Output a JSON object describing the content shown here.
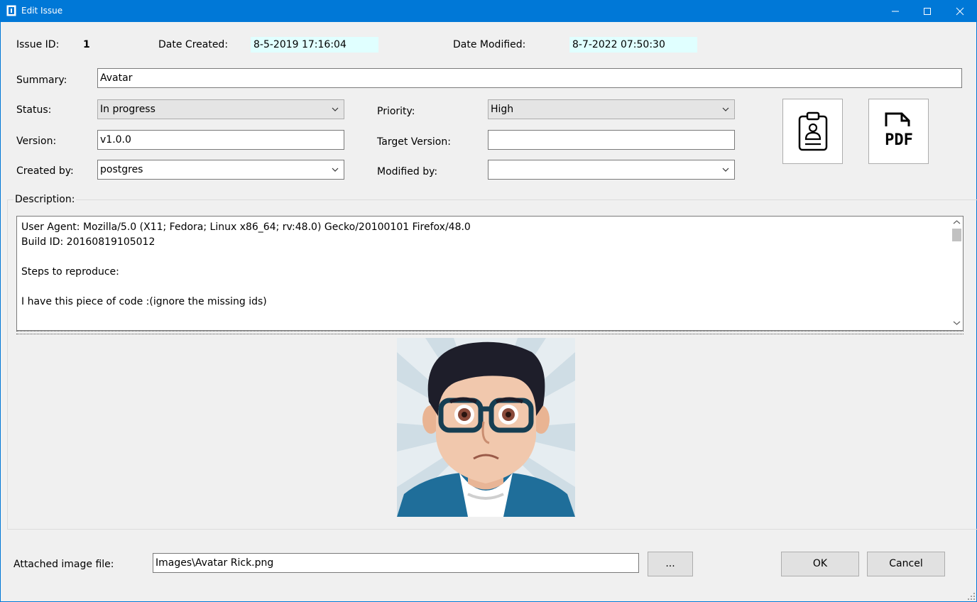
{
  "window": {
    "title": "Edit Issue",
    "minimize_icon": "minimize-icon",
    "maximize_icon": "maximize-icon",
    "close_icon": "close-icon"
  },
  "info": {
    "issue_id_label": "Issue ID:",
    "issue_id": "1",
    "date_created_label": "Date Created:",
    "date_created": "8-5-2019 17:16:04",
    "date_modified_label": "Date Modified:",
    "date_modified": "8-7-2022 07:50:30"
  },
  "form": {
    "summary_label": "Summary:",
    "summary": "Avatar",
    "status_label": "Status:",
    "status": "In progress",
    "priority_label": "Priority:",
    "priority": "High",
    "version_label": "Version:",
    "version": "v1.0.0",
    "target_version_label": "Target Version:",
    "target_version": "",
    "created_by_label": "Created by:",
    "created_by": "postgres",
    "modified_by_label": "Modified by:",
    "modified_by": ""
  },
  "actions": {
    "clipboard_icon": "clipboard-user-icon",
    "pdf_icon": "pdf-file-icon",
    "pdf_text": "PDF"
  },
  "description": {
    "label": "Description:",
    "text": "User Agent: Mozilla/5.0 (X11; Fedora; Linux x86_64; rv:48.0) Gecko/20100101 Firefox/48.0\nBuild ID: 20160819105012\n\nSteps to reproduce:\n\nI have this piece of code :(ignore the missing ids)"
  },
  "image": {
    "alt": "avatar-image"
  },
  "footer": {
    "attached_label": "Attached image file:",
    "attached_file": "Images\\Avatar Rick.png",
    "browse_label": "...",
    "ok_label": "OK",
    "cancel_label": "Cancel"
  },
  "colors": {
    "titlebar": "#0078d7",
    "date_highlight": "#e0ffff"
  }
}
